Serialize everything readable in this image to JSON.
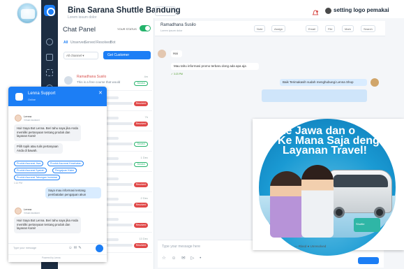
{
  "header": {
    "title": "Bina Sarana Shuttle Bandung",
    "subtitle": "Lorem ipsum dolor",
    "select_label": "▾",
    "setting_text": "setting logo pemakai"
  },
  "chat_panel": {
    "title": "Chat Panel",
    "status_label": "YOUR STATUS",
    "tabs": [
      "All",
      "Unserved",
      "Served",
      "Resolved",
      "Bot"
    ],
    "filter_label": "All channel  ▾",
    "get_customer_label": "Get Customer",
    "conversations": [
      {
        "name": "Ramadhana Susilo",
        "message": "This is a free course that would",
        "time": "4m",
        "badge": "Served"
      },
      {
        "name": "",
        "message": "",
        "time": "",
        "badge": "Resolved"
      },
      {
        "name": "",
        "message": "",
        "time": "7h",
        "badge": "Resolved"
      },
      {
        "name": "",
        "message": "",
        "time": "",
        "badge": "Served"
      },
      {
        "name": "",
        "message": "",
        "time": "1 Dec",
        "badge": "Served"
      },
      {
        "name": "",
        "message": "",
        "time": "",
        "badge": "Resolved"
      },
      {
        "name": "",
        "message": "",
        "time": "2 Dec",
        "badge": "Resolved"
      },
      {
        "name": "",
        "message": "",
        "time": "",
        "badge": "Resolved"
      },
      {
        "name": "",
        "message": "",
        "time": "13 Dec",
        "badge": "Resolved"
      }
    ]
  },
  "main": {
    "contact_name": "Ramadhana Susilo",
    "contact_sub": "Lorem ipsum dolor",
    "actions": [
      "Note",
      "Assign",
      "Email",
      "File",
      "Mark",
      "Search"
    ],
    "messages": {
      "m1": "Hai",
      "m2": "Mau tahu informasi promo terbaru dong ada apa aja",
      "m2_foot": "✓ 3:23 PM",
      "m3": "Baik Terimakasih sudah menghubungi Lenna Shop"
    },
    "input_placeholder": "Type your message here",
    "input_icons": "☆ ☺ ✉ ▷ •",
    "input_extra": "— Rlasd   ● Unresolved ▾"
  },
  "widget": {
    "title": "Lenna Support",
    "status": "Online",
    "bot_name": "Lenna",
    "bot_sub": "Virtual Assistant",
    "bubble1": "Hai! Saya Bot Lenna. Beri tahu saya jika Anda memiliki pertanyaan tentang produk dan layanan Kami!",
    "bubble2": "Pilih topik atau tulis pertanyaan Anda di bawah.",
    "chips": [
      "Produk Asuransi Jiwa",
      "Produk Asuransi Kesehatan",
      "Produk Asuransi Syariah",
      "Pengajuan Klaim",
      "Produk Asuransi Tabungan Investasi"
    ],
    "time1": "1:12 PM",
    "user_msg": "Saya mau informasi tentang pembatalan pengajuan akun",
    "bubble3": "Hai! Saya Bot Lenna. Beri tahu saya jika Anda memiliki pertanyaan tentang produk dan layanan Kami!",
    "input_placeholder": "Type your message",
    "input_icons": "☺✉✎",
    "footer": "Powered by Lenna"
  },
  "promo": {
    "line1": "Ke Jawa dan o",
    "line2": "Ke Mana Saja dengan",
    "line3": "Layanan Travel!",
    "badge": "Shuttle",
    "footer": "— Rlasd   ● Unresolved"
  }
}
